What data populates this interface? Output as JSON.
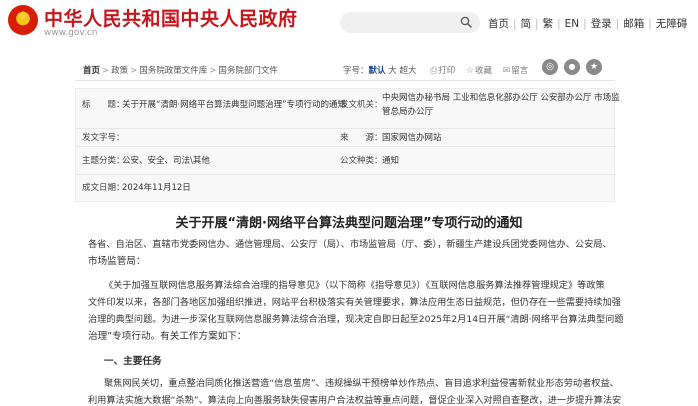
{
  "header": {
    "site_title": "中华人民共和国中央人民政府",
    "site_url": "www.gov.cn",
    "search_placeholder": "",
    "nav": [
      "首页",
      "简",
      "繁",
      "EN",
      "登录",
      "邮箱",
      "无障碍"
    ]
  },
  "breadcrumb": [
    "首页",
    "政策",
    "国务院政策文件库",
    "国务院部门文件"
  ],
  "font_size": {
    "label": "字号：",
    "options": [
      "默认",
      "大",
      "超大"
    ],
    "active": "默认"
  },
  "tools": [
    "打印",
    "收藏",
    "留言"
  ],
  "share_icons": [
    "weibo-icon",
    "wechat-icon",
    "qzone-icon"
  ],
  "meta": {
    "title_label": "标　　题：",
    "title_value": "关于开展“清朗·网络平台算法典型问题治理”专项行动的通知",
    "issuer_label": "发文机关：",
    "issuer_line1": "中央网信办秘书局 工业和信息化部办公厅 公安部办公厅 市场监",
    "issuer_line2": "管总局办公厅",
    "docno_label": "发文字号：",
    "docno_value": "",
    "source_label": "来　　源：",
    "source_value": "国家网信办网站",
    "topic_label": "主题分类：",
    "topic_value": "公安、安全、司法\\其他",
    "type_label": "公文种类：",
    "type_value": "通知",
    "date_label": "成文日期：",
    "date_value": "2024年11月12日"
  },
  "article": {
    "title": "关于开展“清朗·网络平台算法典型问题治理”专项行动的通知",
    "salutation_1": "各省、自治区、直辖市党委网信办、通信管理局、公安厅（局）、市场监管局（厅、委），新疆生产建设兵团党委网信办、公安局、",
    "salutation_2": "市场监管局：",
    "para1_1": "《关于加强互联网信息服务算法综合治理的指导意见》（以下简称《指导意见》）《互联网信息服务算法推荐管理规定》等政策",
    "para1_2": "文件印发以来，各部门各地区加强组织推进，网站平台积极落实有关管理要求，算法应用生态日益规范，但仍存在一些需要持续加强",
    "para1_3": "治理的典型问题。为进一步深化互联网信息服务算法综合治理，现决定自即日起至2025年2月14日开展“清朗·网络平台算法典型问题",
    "para1_4": "治理”专项行动。有关工作方案如下：",
    "heading1": "一、主要任务",
    "para2_1": "聚焦网民关切，重点整治同质化推送营造“信息茧房”、违规操纵干预榜单炒作热点、盲目追求利益侵害新就业形态劳动者权益、",
    "para2_2": "利用算法实施大数据“杀熟”、算法向上向善服务缺失侵害用户合法权益等重点问题，督促企业深入对照自查整改，进一步提升算法安"
  }
}
